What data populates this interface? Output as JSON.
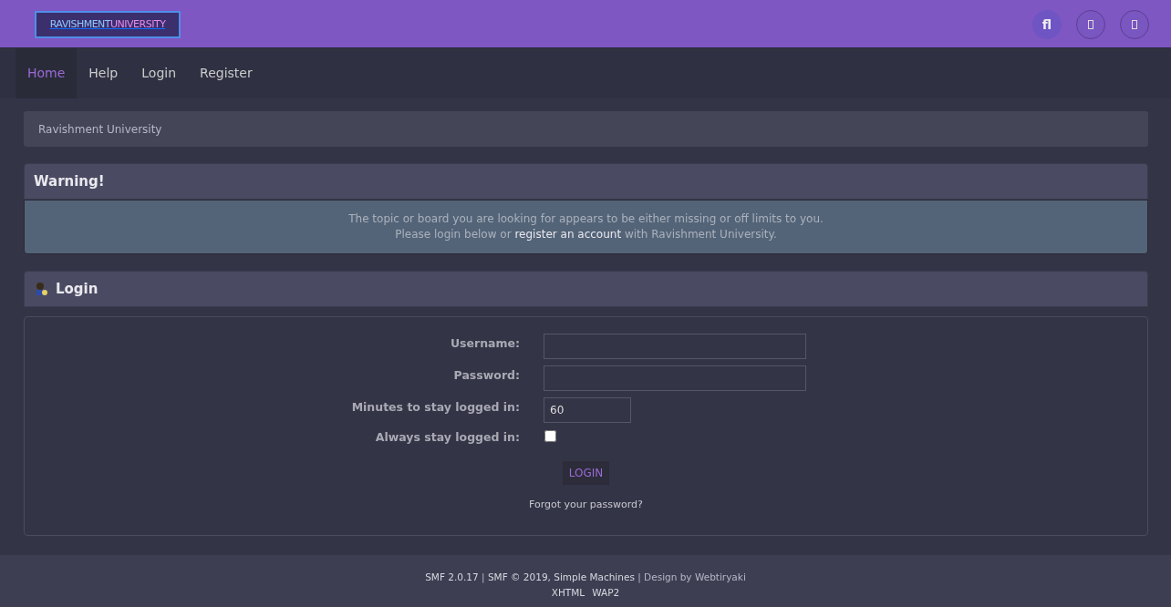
{
  "header": {
    "logo": {
      "part_1": "RAVISHMENT",
      "part_2": "UNIVERSITY"
    },
    "icon_buttons": [
      {
        "kind": "text",
        "label": "fl"
      },
      {
        "kind": "glyph"
      },
      {
        "kind": "glyph"
      }
    ]
  },
  "nav": [
    {
      "label": "Home",
      "selected": true
    },
    {
      "label": "Help",
      "selected": false
    },
    {
      "label": "Login",
      "selected": false
    },
    {
      "label": "Register",
      "selected": false
    }
  ],
  "breadcrumb": "Ravishment University",
  "warning": {
    "title": "Warning!",
    "line_1": "The topic or board you are looking for appears to be either missing or off limits to you.",
    "line_2_before": "Please login below or",
    "line_2_link": "register an account",
    "line_2_after": "with Ravishment University."
  },
  "login": {
    "title": "Login",
    "fields": [
      {
        "kind": "text",
        "label": "Username:"
      },
      {
        "kind": "password",
        "label": "Password:"
      },
      {
        "kind": "short",
        "label": "Minutes to stay logged in:",
        "value": "60"
      },
      {
        "kind": "checkbox",
        "label": "Always stay logged in:",
        "checked": false
      }
    ],
    "button": "LOGIN",
    "forgot": "Forgot your password?"
  },
  "footer": {
    "separator": "|",
    "line_1": [
      {
        "text": "SMF 2.0.17",
        "kind": "link"
      },
      {
        "text": "SMF © 2019, Simple Machines",
        "kind": "link"
      },
      {
        "text": "Design by Webtiryaki",
        "kind": "credit"
      }
    ],
    "line_2": [
      "XHTML",
      "WAP2"
    ]
  }
}
